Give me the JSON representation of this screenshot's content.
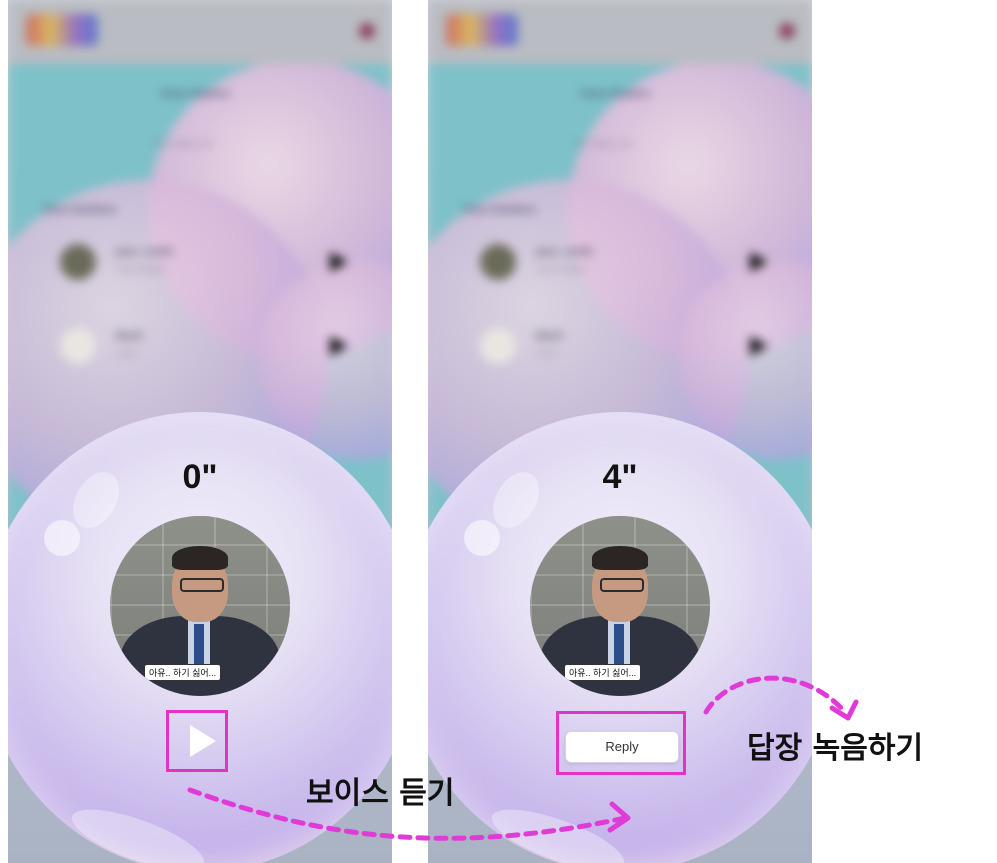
{
  "left_screen": {
    "header": {
      "logo": "app-logo",
      "menu_icon": "menu-icon"
    },
    "voice_replies": {
      "title": "Voice Replies",
      "empty_text": "No reply yet"
    },
    "voice_bubbles": {
      "title": "Voice Bubbles",
      "items": [
        {
          "name": "jane_smith",
          "subtitle": "voice bubble"
        },
        {
          "name": "Basil",
          "subtitle": "voice"
        }
      ]
    },
    "player": {
      "timer": "0\"",
      "caption": "아유.. 하기 싫어...",
      "play_icon": "play-icon"
    }
  },
  "right_screen": {
    "header": {
      "logo": "app-logo",
      "menu_icon": "menu-icon"
    },
    "voice_replies": {
      "title": "Voice Replies",
      "empty_text": "No reply yet"
    },
    "voice_bubbles": {
      "title": "Voice Bubbles",
      "items": [
        {
          "name": "jane_smith",
          "subtitle": "voice bubble"
        },
        {
          "name": "Basil",
          "subtitle": "voice"
        }
      ]
    },
    "player": {
      "timer": "4\"",
      "caption": "아유.. 하기 싫어...",
      "reply_label": "Reply"
    }
  },
  "annotations": {
    "listen_voice": "보이스 듣기",
    "record_reply": "답장 녹음하기"
  },
  "colors": {
    "highlight": "#e333c4",
    "arrow": "#e03bd6",
    "teal_background": "#7ec1c9",
    "bubble": "#d2c6ef"
  }
}
